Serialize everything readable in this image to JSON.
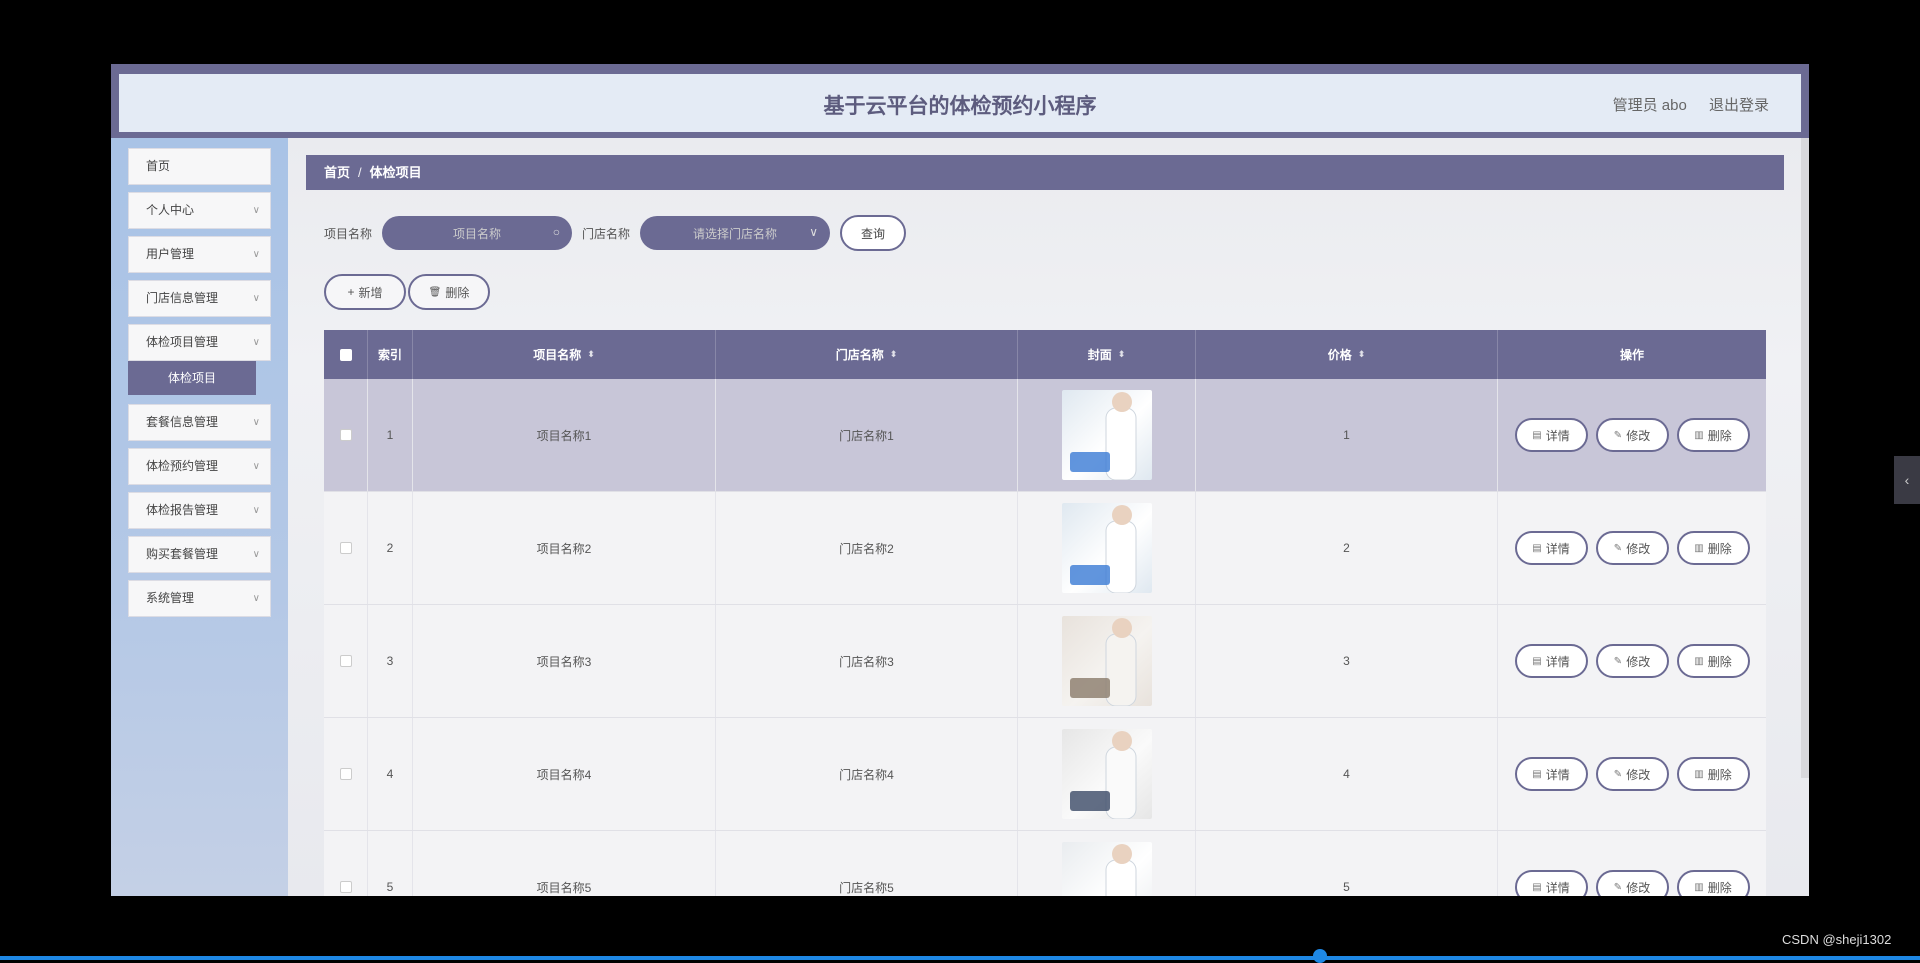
{
  "header": {
    "title": "基于云平台的体检预约小程序",
    "user_label": "管理员 abo",
    "logout_label": "退出登录"
  },
  "sidebar": {
    "items": [
      {
        "label": "首页",
        "has_chevron": false
      },
      {
        "label": "个人中心",
        "has_chevron": true
      },
      {
        "label": "用户管理",
        "has_chevron": true
      },
      {
        "label": "门店信息管理",
        "has_chevron": true
      },
      {
        "label": "体检项目管理",
        "has_chevron": true
      },
      {
        "label": "套餐信息管理",
        "has_chevron": true
      },
      {
        "label": "体检预约管理",
        "has_chevron": true
      },
      {
        "label": "体检报告管理",
        "has_chevron": true
      },
      {
        "label": "购买套餐管理",
        "has_chevron": true
      },
      {
        "label": "系统管理",
        "has_chevron": true
      }
    ],
    "active_sub": "体检项目"
  },
  "breadcrumb": {
    "home": "首页",
    "sep": "/",
    "current": "体检项目"
  },
  "search": {
    "project_label": "项目名称",
    "project_placeholder": "项目名称",
    "store_label": "门店名称",
    "store_placeholder": "请选择门店名称",
    "query_button": "查询"
  },
  "actions": {
    "add": "新增",
    "delete": "删除"
  },
  "table": {
    "headers": [
      "索引",
      "项目名称",
      "门店名称",
      "封面",
      "价格",
      "操作"
    ],
    "rows": [
      {
        "index": "1",
        "name": "项目名称1",
        "store": "门店名称1",
        "price": "1"
      },
      {
        "index": "2",
        "name": "项目名称2",
        "store": "门店名称2",
        "price": "2"
      },
      {
        "index": "3",
        "name": "项目名称3",
        "store": "门店名称3",
        "price": "3"
      },
      {
        "index": "4",
        "name": "项目名称4",
        "store": "门店名称4",
        "price": "4"
      },
      {
        "index": "5",
        "name": "项目名称5",
        "store": "门店名称5",
        "price": "5"
      }
    ],
    "row_ops": [
      "详情",
      "修改",
      "删除"
    ]
  },
  "colors": {
    "accent": "#6b6a93",
    "sidebar_bg": "#a9c3e6",
    "header_bg": "#e4ebf5"
  },
  "overlay": {
    "watermark": "CSDN @sheji1302"
  }
}
